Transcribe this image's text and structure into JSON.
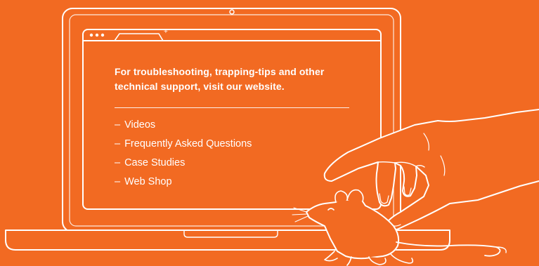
{
  "colors": {
    "background": "#F26A22",
    "line": "#FFFFFF"
  },
  "headline": "For troubleshooting, trapping-tips and other technical support, visit our website.",
  "links": [
    {
      "label": "Videos"
    },
    {
      "label": "Frequently Asked Questions"
    },
    {
      "label": "Case Studies"
    },
    {
      "label": "Web Shop"
    }
  ],
  "browser": {
    "new_tab_glyph": "+",
    "window_controls": [
      "dot",
      "dot",
      "dot"
    ]
  },
  "icons": [
    "laptop-icon",
    "webcam-icon",
    "browser-dots-icon",
    "browser-tab-icon",
    "hand-icon",
    "mouse-icon"
  ]
}
